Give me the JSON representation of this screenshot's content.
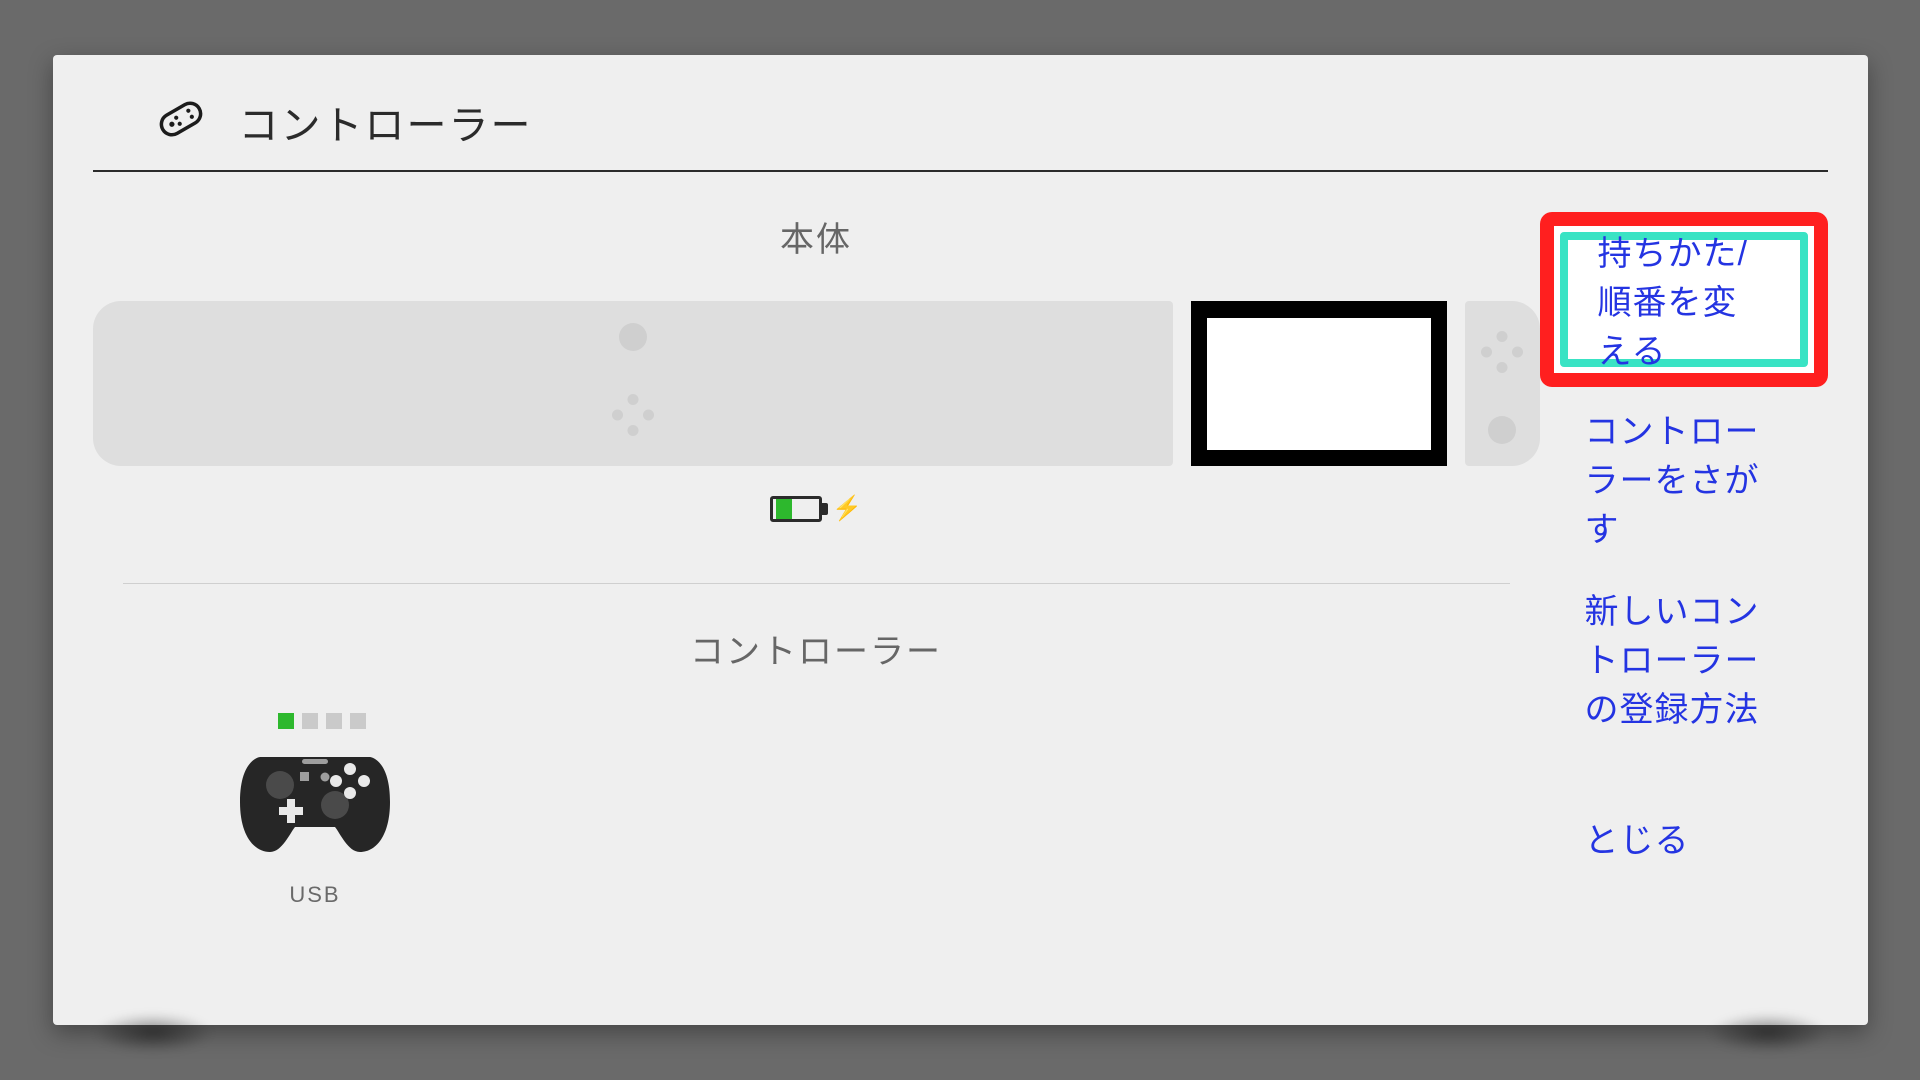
{
  "header": {
    "title": "コントローラー"
  },
  "left": {
    "console_label": "本体",
    "battery_level": 0.4,
    "charging": true,
    "controllers_label": "コントローラー",
    "controller1": {
      "kind": "pro-controller",
      "player": 1,
      "connection": "USB"
    }
  },
  "menu": {
    "items": [
      {
        "label": "持ちかた/順番を変える",
        "selected": true
      },
      {
        "label": "コントローラーをさがす",
        "selected": false
      },
      {
        "label": "新しいコントローラーの登録方法",
        "selected": false
      },
      {
        "label": "とじる",
        "selected": false
      }
    ]
  },
  "colors": {
    "accent_cyan": "#39e3c4",
    "highlight_red": "#ff1f1f",
    "link_blue": "#2434e2",
    "battery_green": "#2db82d"
  }
}
